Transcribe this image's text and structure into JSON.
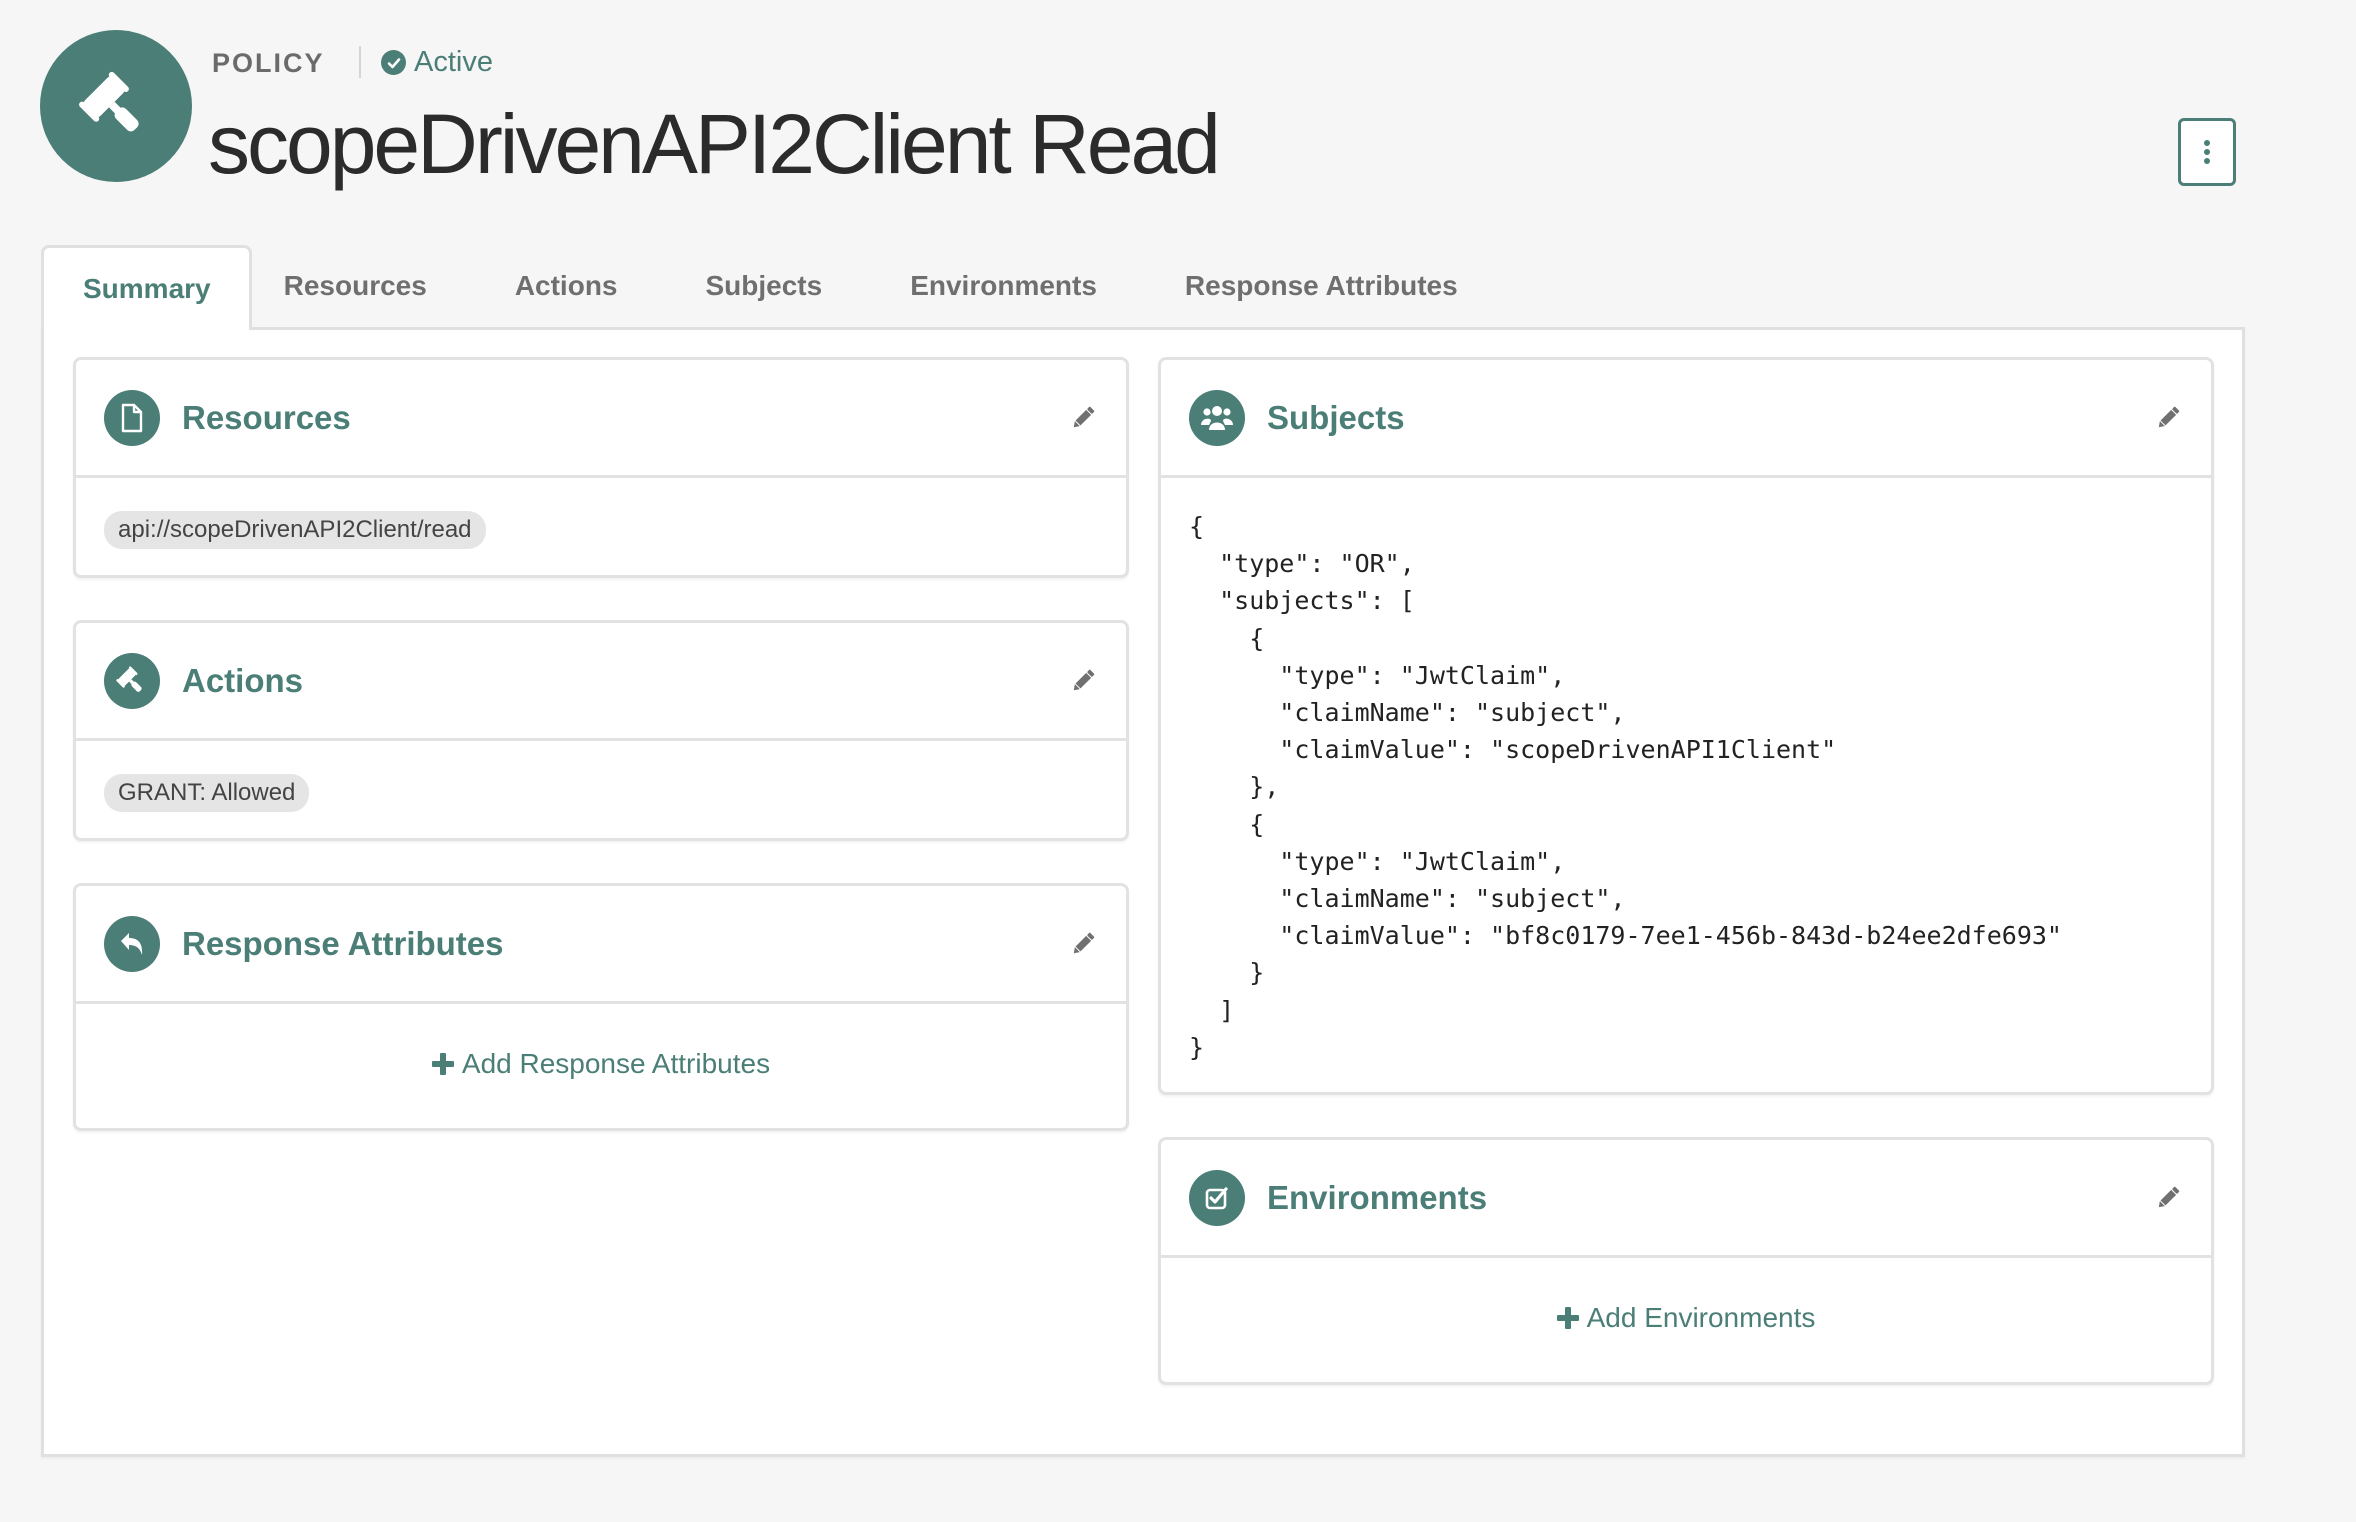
{
  "header": {
    "type_label": "POLICY",
    "status": "Active",
    "title": "scopeDrivenAPI2Client Read",
    "icon": "gavel-icon",
    "menu_icon": "kebab-vertical-icon"
  },
  "tabs": [
    {
      "label": "Summary",
      "active": true
    },
    {
      "label": "Resources",
      "active": false
    },
    {
      "label": "Actions",
      "active": false
    },
    {
      "label": "Subjects",
      "active": false
    },
    {
      "label": "Environments",
      "active": false
    },
    {
      "label": "Response Attributes",
      "active": false
    }
  ],
  "cards": {
    "resources": {
      "title": "Resources",
      "icon": "file-icon",
      "items": [
        "api://scopeDrivenAPI2Client/read"
      ]
    },
    "actions": {
      "title": "Actions",
      "icon": "gavel-icon",
      "items": [
        "GRANT: Allowed"
      ]
    },
    "response_attributes": {
      "title": "Response Attributes",
      "icon": "reply-icon",
      "add_label": "Add Response Attributes"
    },
    "subjects": {
      "title": "Subjects",
      "icon": "users-icon",
      "code": "{\n  \"type\": \"OR\",\n  \"subjects\": [\n    {\n      \"type\": \"JwtClaim\",\n      \"claimName\": \"subject\",\n      \"claimValue\": \"scopeDrivenAPI1Client\"\n    },\n    {\n      \"type\": \"JwtClaim\",\n      \"claimName\": \"subject\",\n      \"claimValue\": \"bf8c0179-7ee1-456b-843d-b24ee2dfe693\"\n    }\n  ]\n}"
    },
    "environments": {
      "title": "Environments",
      "icon": "checkbox-icon",
      "add_label": "Add Environments"
    }
  },
  "colors": {
    "accent": "#4a7e76",
    "tab_inactive": "#6f6f6f",
    "background": "#f6f6f6",
    "border": "#e2e2e2"
  }
}
